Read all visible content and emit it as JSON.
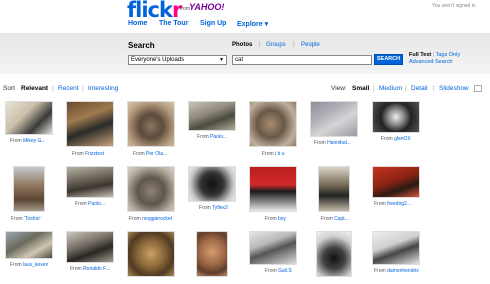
{
  "header": {
    "logo_a": "flick",
    "logo_b": "r",
    "from": "from",
    "yahoo": "YAHOO!",
    "signin": "You aren't signed in",
    "nav": [
      "Home",
      "The Tour",
      "Sign Up",
      "Explore ▾"
    ]
  },
  "search": {
    "title": "Search",
    "tabs": [
      "Photos",
      "Groups",
      "People"
    ],
    "scope": "Everyone's Uploads",
    "query": "cat",
    "button": "SEARCH",
    "full_text": "Full Text",
    "tags_only": "Tags Only",
    "advanced": "Advanced Search"
  },
  "sort": {
    "label": "Sort",
    "options": [
      "Relevant",
      "Recent",
      "Interesting"
    ],
    "view_label": "View:",
    "views": [
      "Small",
      "Medium",
      "Detail",
      "Slideshow"
    ]
  },
  "photos": [
    {
      "from": "From ",
      "name": "Mikey G..."
    },
    {
      "from": "From ",
      "name": "Frizztext"
    },
    {
      "from": "From ",
      "name": "Per Ola..."
    },
    {
      "from": "From ",
      "name": "Paolo..."
    },
    {
      "from": "From ",
      "name": "i b u"
    },
    {
      "from": "From ",
      "name": "Hannibal..."
    },
    {
      "from": "From ",
      "name": "glenOX"
    },
    {
      "from": "From ",
      "name": "'Toshio'"
    },
    {
      "from": "From ",
      "name": "Paolo..."
    },
    {
      "from": "From ",
      "name": "moggierocket"
    },
    {
      "from": "From ",
      "name": "Tyflex2"
    },
    {
      "from": "From ",
      "name": "bsy"
    },
    {
      "from": "From ",
      "name": "Capt..."
    },
    {
      "from": "From ",
      "name": "freedog2..."
    },
    {
      "from": "From ",
      "name": "lauv_keven"
    },
    {
      "from": "From ",
      "name": "Ronaldo F..."
    },
    {
      "from": "",
      "name": ""
    },
    {
      "from": "",
      "name": ""
    },
    {
      "from": "From ",
      "name": "Gail.S"
    },
    {
      "from": "",
      "name": ""
    },
    {
      "from": "From ",
      "name": "damonhendrix"
    }
  ]
}
